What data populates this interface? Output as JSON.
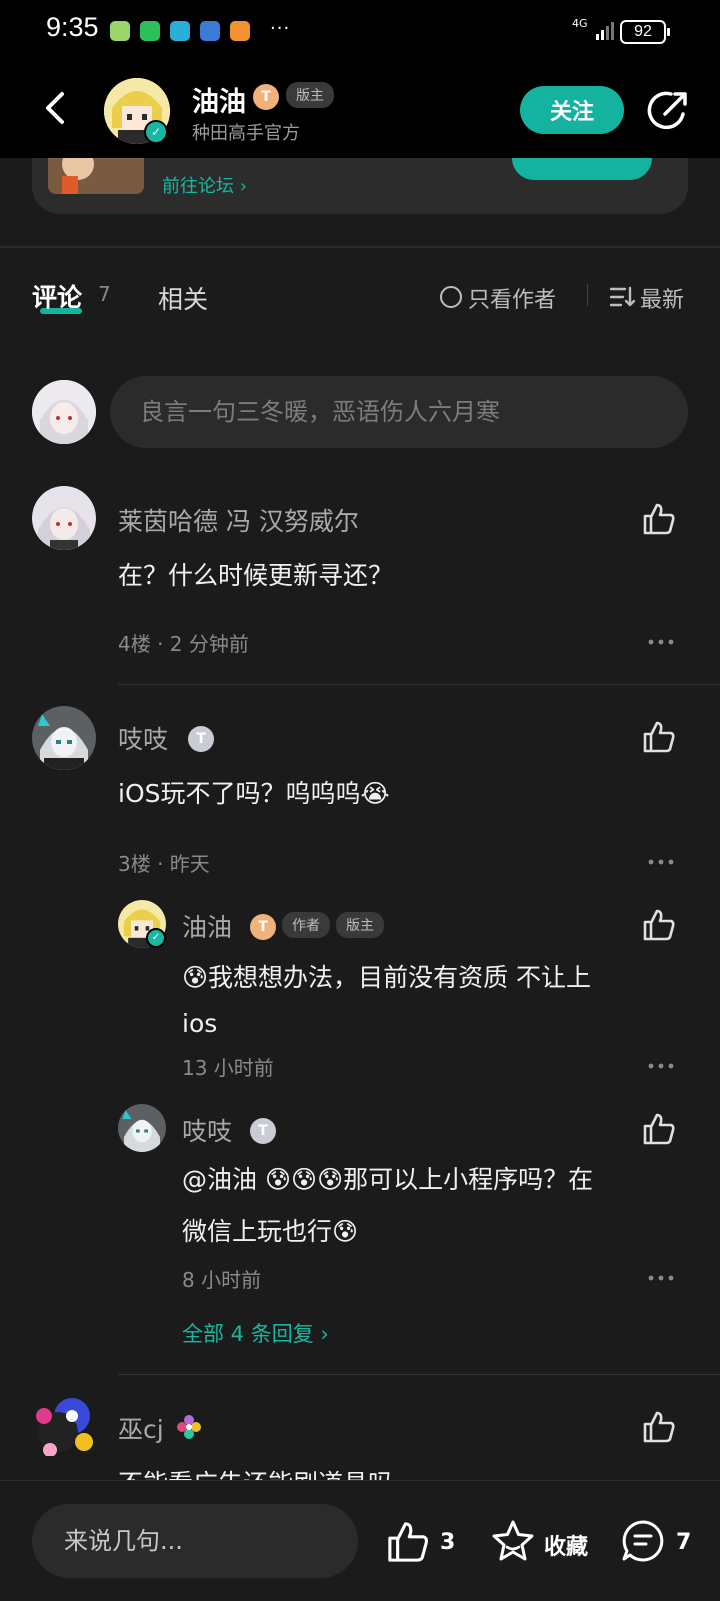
{
  "status_bar": {
    "time": "9:35",
    "network": "4G",
    "battery": "92",
    "more": "···"
  },
  "header": {
    "name": "油油",
    "level": "T",
    "badge": "版主",
    "subtitle": "种田高手官方",
    "follow_label": "关注"
  },
  "forum_card": {
    "link_label": "前往论坛 ›"
  },
  "tabs": {
    "comments_label": "评论",
    "comments_count": "7",
    "related_label": "相关",
    "author_only_label": "只看作者",
    "sort_label": "最新"
  },
  "comment_input": {
    "placeholder": "良言一句三冬暖，恶语伤人六月寒"
  },
  "comments": [
    {
      "name": "莱茵哈德 冯 汉努威尔",
      "text": "在？什么时候更新寻还？",
      "meta": "4楼 · 2 分钟前"
    },
    {
      "name": "吱吱",
      "level": "T",
      "text": "iOS玩不了吗？呜呜呜😭",
      "meta": "3楼 · 昨天",
      "replies": [
        {
          "name": "油油",
          "level": "T",
          "tags": [
            "作者",
            "版主"
          ],
          "text_line1": "😰我想想办法，目前没有资质 不让上",
          "text_line2": "ios",
          "meta": "13 小时前"
        },
        {
          "name": "吱吱",
          "level": "T",
          "text_line1": "@油油  😰😰😰那可以上小程序吗？在",
          "text_line2": "微信上玩也行😰",
          "meta": "8 小时前"
        }
      ],
      "all_replies_label": "全部 4 条回复 ›"
    },
    {
      "name": "巫cj",
      "text": "不能看广告还能刷道具吗"
    }
  ],
  "bottom_bar": {
    "input_label": "来说几句...",
    "like_count": "3",
    "favorite_label": "收藏",
    "comment_count": "7"
  },
  "colors": {
    "accent": "#14b39f",
    "background": "#1b1b1b"
  }
}
